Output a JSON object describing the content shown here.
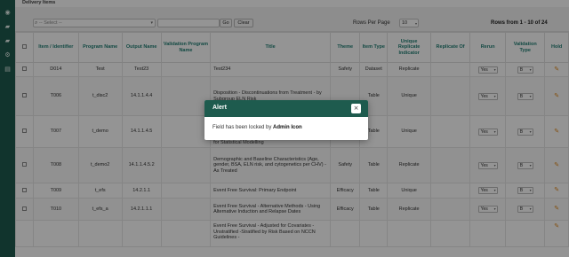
{
  "sidebar": {
    "items": [
      {
        "icon": "dashboard-icon",
        "glyph": "◉"
      },
      {
        "icon": "folder-icon",
        "glyph": "▰"
      },
      {
        "icon": "folder-open-icon",
        "glyph": "▰"
      },
      {
        "icon": "settings-icon",
        "glyph": "⚙"
      },
      {
        "icon": "document-icon",
        "glyph": "▤"
      }
    ]
  },
  "panel": {
    "title": "Delivery Items"
  },
  "filter": {
    "select_placeholder": "-- Select --",
    "go_label": "Go",
    "clear_label": "Clear",
    "rows_per_page_label": "Rows Per Page",
    "rows_per_page_value": "10",
    "rows_info": "Rows from 1 - 10 of 24"
  },
  "table": {
    "headers": {
      "item_id": "Item / Identifier",
      "program": "Program Name",
      "output": "Output Name",
      "validation_program": "Validation Program Name",
      "title": "Title",
      "theme": "Theme",
      "item_type": "Item Type",
      "unique": "Unique Replicate Indicator",
      "replicate_of": "Replicate Of",
      "rerun": "Rerun",
      "validation_type": "Validation Type",
      "hold": "Hold"
    },
    "rows": [
      {
        "id": "D014",
        "program": "Test",
        "output": "Test23",
        "validation_program": "",
        "title": "Test234",
        "theme": "Safety",
        "item_type": "Dataset",
        "unique": "Replicate",
        "replicate_of": "",
        "rerun": "Yes",
        "validation": "B"
      },
      {
        "id": "T006",
        "program": "t_disc2",
        "output": "14.1.1.4.4",
        "validation_program": "",
        "title": "Disposition - Discontinuations from Treatment - by Subgroup ELN Risk",
        "theme": "",
        "item_type": "Table",
        "unique": "Unique",
        "replicate_of": "",
        "rerun": "Yes",
        "validation": "B"
      },
      {
        "id": "T007",
        "program": "t_demo",
        "output": "14.1.1.4.5",
        "validation_program": "",
        "title": "for Statistical Modelling",
        "theme": "",
        "item_type": "Table",
        "unique": "Unique",
        "replicate_of": "",
        "rerun": "Yes",
        "validation": "B"
      },
      {
        "id": "T008",
        "program": "t_demo2",
        "output": "14.1.1.4.5.2",
        "validation_program": "",
        "title": "Demographic and Baseline Characteristics (Age, gender, BSA, ELN risk, and cytogenetics per CHV) - As Treated",
        "theme": "Safety",
        "item_type": "Table",
        "unique": "Replicate",
        "replicate_of": "",
        "rerun": "Yes",
        "validation": "B"
      },
      {
        "id": "T009",
        "program": "t_efs",
        "output": "14.2.1.1",
        "validation_program": "",
        "title": "Event Free Survival: Primary Endpoint",
        "theme": "Efficacy",
        "item_type": "Table",
        "unique": "Unique",
        "replicate_of": "",
        "rerun": "Yes",
        "validation": "B"
      },
      {
        "id": "T010",
        "program": "t_efs_a",
        "output": "14.2.1.1.1",
        "validation_program": "",
        "title": "Event Free Survival - Alternative Methods - Using Alternative Induction and Relapse Dates",
        "theme": "Efficacy",
        "item_type": "Table",
        "unique": "Replicate",
        "replicate_of": "",
        "rerun": "Yes",
        "validation": "B"
      },
      {
        "id": "",
        "program": "",
        "output": "",
        "validation_program": "",
        "title": "Event Free Survival - Adjusted for Covariates -Unstratified -Stratified by Risk Based on NCCN Guidelines -",
        "theme": "",
        "item_type": "",
        "unique": "",
        "replicate_of": "",
        "rerun": "",
        "validation": ""
      }
    ]
  },
  "alert": {
    "title": "Alert",
    "close_glyph": "×",
    "message_prefix": "Field has been locked by ",
    "message_user": "Admin Icon"
  }
}
